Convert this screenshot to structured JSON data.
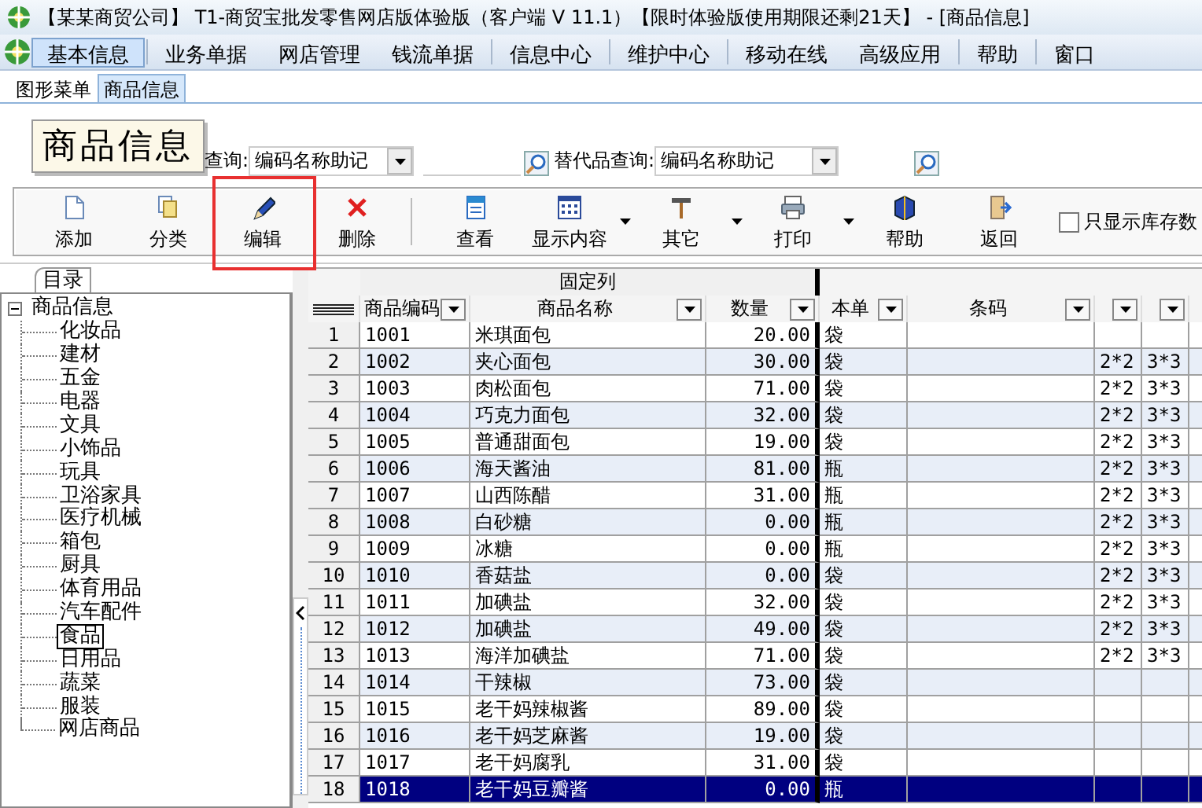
{
  "window": {
    "title": "【某某商贸公司】 T1-商贸宝批发零售网店版体验版（客户端 V 11.1）【限时体验版使用期限还剩21天】 - [商品信息]"
  },
  "menu_bar": [
    {
      "label": "基本信息",
      "selected": true
    },
    {
      "label": "业务单据",
      "selected": false
    },
    {
      "label": "网店管理",
      "selected": false
    },
    {
      "label": "钱流单据",
      "selected": false
    },
    {
      "label": "信息中心",
      "selected": false
    },
    {
      "label": "维护中心",
      "selected": false
    },
    {
      "label": "移动在线",
      "selected": false
    },
    {
      "label": "高级应用",
      "selected": false
    },
    {
      "label": "帮助",
      "selected": false
    },
    {
      "label": "窗口",
      "selected": false
    }
  ],
  "tabs": [
    {
      "label": "图形菜单",
      "selected": false
    },
    {
      "label": "商品信息",
      "selected": true
    }
  ],
  "header": {
    "logo": "商品信息",
    "query_label": "查询:",
    "query_mode": "编码名称助记",
    "alt_query_label": "替代品查询:",
    "alt_query_mode": "编码名称助记"
  },
  "toolbar": [
    {
      "label": "添加",
      "dropdown": false,
      "highlighted": false
    },
    {
      "label": "分类",
      "dropdown": false,
      "highlighted": false
    },
    {
      "label": "编辑",
      "dropdown": false,
      "highlighted": true
    },
    {
      "label": "删除",
      "dropdown": false,
      "highlighted": false
    },
    {
      "label": "查看",
      "dropdown": false,
      "highlighted": false
    },
    {
      "label": "显示内容",
      "dropdown": true,
      "highlighted": false
    },
    {
      "label": "其它",
      "dropdown": true,
      "highlighted": false
    },
    {
      "label": "打印",
      "dropdown": true,
      "highlighted": false
    },
    {
      "label": "帮助",
      "dropdown": false,
      "highlighted": false
    },
    {
      "label": "返回",
      "dropdown": false,
      "highlighted": false
    }
  ],
  "stock_only": {
    "label": "只显示库存数",
    "checked": false
  },
  "tree": {
    "tab": "目录",
    "root": {
      "label": "商品信息",
      "expanded": true,
      "selected": false,
      "children": [
        {
          "label": "化妆品",
          "selected": false
        },
        {
          "label": "建材",
          "selected": false
        },
        {
          "label": "五金",
          "selected": false
        },
        {
          "label": "电器",
          "selected": false
        },
        {
          "label": "文具",
          "selected": false
        },
        {
          "label": "小饰品",
          "selected": false
        },
        {
          "label": "玩具",
          "selected": false
        },
        {
          "label": "卫浴家具",
          "selected": false
        },
        {
          "label": "医疗机械",
          "selected": false
        },
        {
          "label": "箱包",
          "selected": false
        },
        {
          "label": "厨具",
          "selected": false
        },
        {
          "label": "体育用品",
          "selected": false
        },
        {
          "label": "汽车配件",
          "selected": false
        },
        {
          "label": "食品",
          "selected": true
        },
        {
          "label": "日用品",
          "selected": false
        },
        {
          "label": "蔬菜",
          "selected": false
        },
        {
          "label": "服装",
          "selected": false
        },
        {
          "label": "网店商品",
          "selected": false
        }
      ]
    }
  },
  "grid": {
    "group_header": "固定列",
    "columns": [
      "商品编码",
      "商品名称",
      "数量",
      "本单",
      "条码"
    ],
    "rows": [
      {
        "no": "1",
        "code": "1001",
        "name": "米琪面包",
        "qty": "20.00",
        "unit": "袋",
        "selected": false
      },
      {
        "no": "2",
        "code": "1002",
        "name": "夹心面包",
        "qty": "30.00",
        "unit": "袋",
        "column_7": "2*2",
        "column_8": "3*3",
        "selected": false
      },
      {
        "no": "3",
        "code": "1003",
        "name": "肉松面包",
        "qty": "71.00",
        "unit": "袋",
        "column_7": "2*2",
        "column_8": "3*3",
        "selected": false
      },
      {
        "no": "4",
        "code": "1004",
        "name": "巧克力面包",
        "qty": "32.00",
        "unit": "袋",
        "column_7": "2*2",
        "column_8": "3*3",
        "selected": false
      },
      {
        "no": "5",
        "code": "1005",
        "name": "普通甜面包",
        "qty": "19.00",
        "unit": "袋",
        "column_7": "2*2",
        "column_8": "3*3",
        "selected": false
      },
      {
        "no": "6",
        "code": "1006",
        "name": "海天酱油",
        "qty": "81.00",
        "unit": "瓶",
        "column_7": "2*2",
        "column_8": "3*3",
        "selected": false
      },
      {
        "no": "7",
        "code": "1007",
        "name": "山西陈醋",
        "qty": "31.00",
        "unit": "瓶",
        "column_7": "2*2",
        "column_8": "3*3",
        "selected": false
      },
      {
        "no": "8",
        "code": "1008",
        "name": "白砂糖",
        "qty": "0.00",
        "unit": "瓶",
        "column_7": "2*2",
        "column_8": "3*3",
        "selected": false
      },
      {
        "no": "9",
        "code": "1009",
        "name": "冰糖",
        "qty": "0.00",
        "unit": "瓶",
        "column_7": "2*2",
        "column_8": "3*3",
        "selected": false
      },
      {
        "no": "10",
        "code": "1010",
        "name": "香菇盐",
        "qty": "0.00",
        "unit": "袋",
        "column_7": "2*2",
        "column_8": "3*3",
        "selected": false
      },
      {
        "no": "11",
        "code": "1011",
        "name": "加碘盐",
        "qty": "32.00",
        "unit": "袋",
        "column_7": "2*2",
        "column_8": "3*3",
        "selected": false
      },
      {
        "no": "12",
        "code": "1012",
        "name": "加碘盐",
        "qty": "49.00",
        "unit": "袋",
        "column_7": "2*2",
        "column_8": "3*3",
        "selected": false
      },
      {
        "no": "13",
        "code": "1013",
        "name": "海洋加碘盐",
        "qty": "71.00",
        "unit": "袋",
        "column_7": "2*2",
        "column_8": "3*3",
        "selected": false
      },
      {
        "no": "14",
        "code": "1014",
        "name": "干辣椒",
        "qty": "73.00",
        "unit": "袋",
        "selected": false
      },
      {
        "no": "15",
        "code": "1015",
        "name": "老干妈辣椒酱",
        "qty": "89.00",
        "unit": "袋",
        "selected": false
      },
      {
        "no": "16",
        "code": "1016",
        "name": "老干妈芝麻酱",
        "qty": "19.00",
        "unit": "袋",
        "selected": false
      },
      {
        "no": "17",
        "code": "1017",
        "name": "老干妈腐乳",
        "qty": "31.00",
        "unit": "袋",
        "selected": false
      },
      {
        "no": "18",
        "code": "1018",
        "name": "老干妈豆瓣酱",
        "qty": "0.00",
        "unit": "瓶",
        "selected": true
      }
    ]
  }
}
